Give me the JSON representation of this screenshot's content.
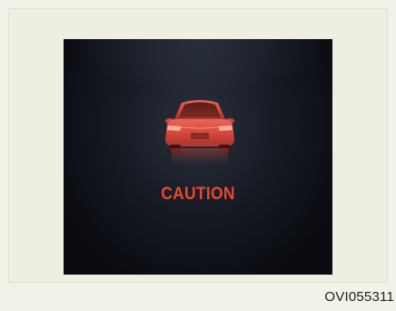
{
  "display": {
    "icon": "car-rear-icon",
    "warning_label": "CAUTION",
    "warning_color": "#e94630"
  },
  "figure": {
    "code": "OVI055311"
  }
}
